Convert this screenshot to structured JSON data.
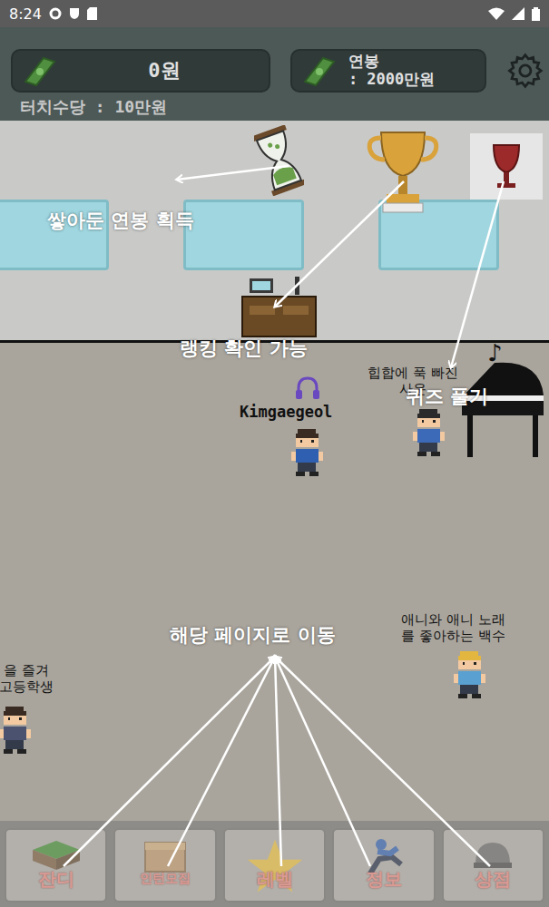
{
  "status_bar": {
    "time": "8:24"
  },
  "hud": {
    "money": "0원",
    "salary_label": "연봉",
    "salary_value": ": 2000만원",
    "touch_pay": "터치수당 : 10만원"
  },
  "player": {
    "name": "Kimgaegeol"
  },
  "npcs": [
    {
      "lines": [
        "힙합에 푹 빠진",
        "사운"
      ],
      "note": "♪"
    },
    {
      "lines": [
        "을 즐겨",
        "고등학생"
      ],
      "note": ""
    },
    {
      "lines": [
        "애니와 애니 노래",
        "를 좋아하는 백수"
      ],
      "note": ""
    }
  ],
  "nav": [
    {
      "label": "잔디",
      "kind": "grass"
    },
    {
      "label": "인턴모집",
      "kind": "box"
    },
    {
      "label": "레벨",
      "kind": "star"
    },
    {
      "label": "정보",
      "kind": "runner"
    },
    {
      "label": "상점",
      "kind": "helmet"
    }
  ],
  "annotations": [
    {
      "text": "쌓아둔 연봉 획득"
    },
    {
      "text": "랭킹 확인 가능"
    },
    {
      "text": "퀴즈 풀기"
    },
    {
      "text": "해당 페이지로 이동"
    }
  ]
}
